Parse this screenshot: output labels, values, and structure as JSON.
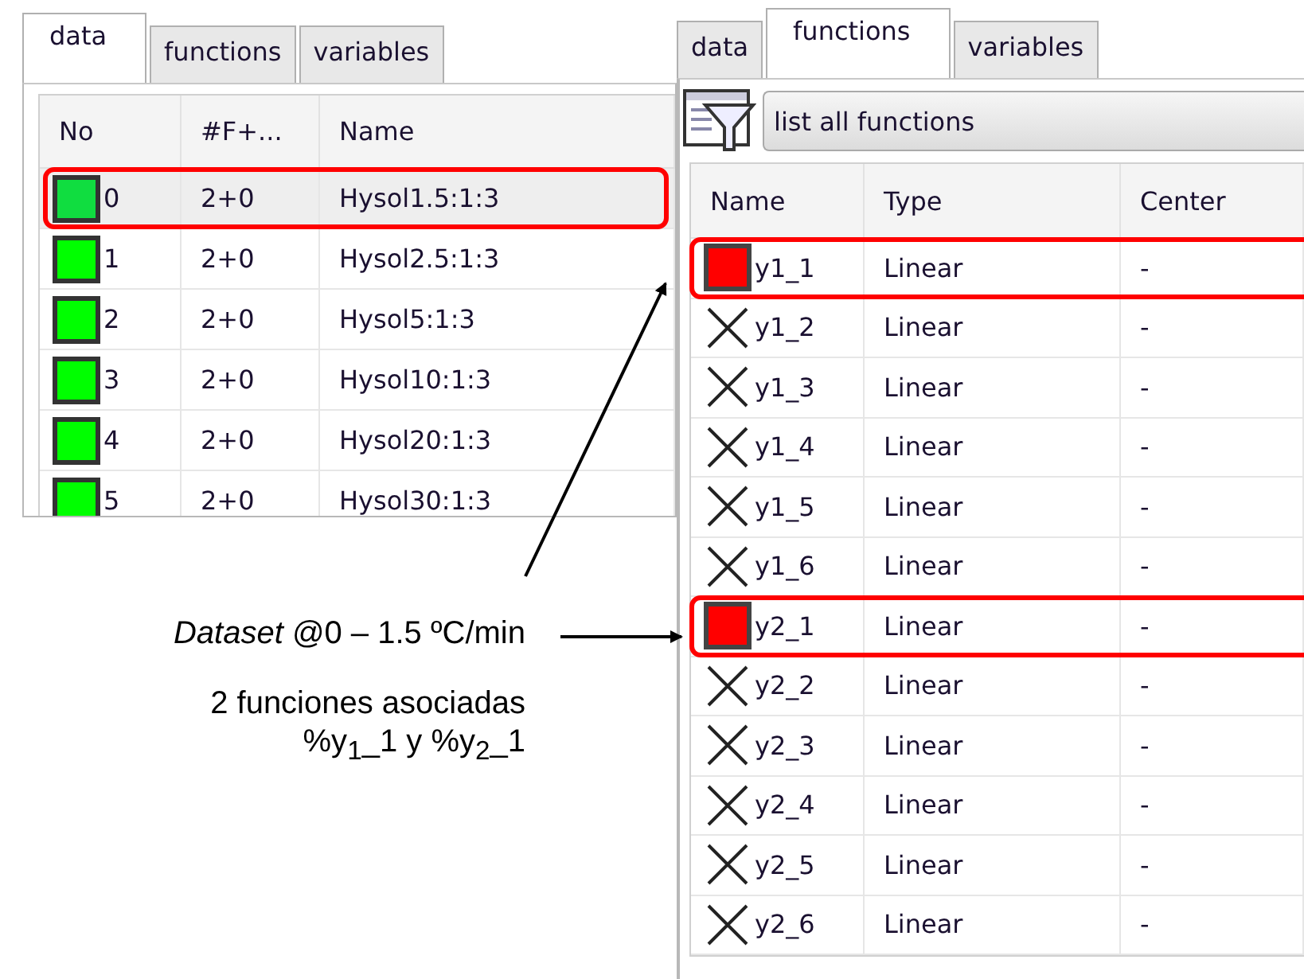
{
  "left_panel": {
    "tabs": [
      {
        "label": "data",
        "selected": true
      },
      {
        "label": "functions",
        "selected": false
      },
      {
        "label": "variables",
        "selected": false
      }
    ],
    "columns": [
      "No",
      "#F+...",
      "Name"
    ],
    "rows": [
      {
        "no": "0",
        "functions": "2+0",
        "name": "Hysol1.5:1:3",
        "selected": true,
        "highlighted": true
      },
      {
        "no": "1",
        "functions": "2+0",
        "name": "Hysol2.5:1:3",
        "selected": false,
        "highlighted": false
      },
      {
        "no": "2",
        "functions": "2+0",
        "name": "Hysol5:1:3",
        "selected": false,
        "highlighted": false
      },
      {
        "no": "3",
        "functions": "2+0",
        "name": "Hysol10:1:3",
        "selected": false,
        "highlighted": false
      },
      {
        "no": "4",
        "functions": "2+0",
        "name": "Hysol20:1:3",
        "selected": false,
        "highlighted": false
      },
      {
        "no": "5",
        "functions": "2+0",
        "name": "Hysol30:1:3",
        "selected": false,
        "highlighted": false
      }
    ]
  },
  "annotation": {
    "caption": "*Dataset* @0 – 1.5 ºC/min",
    "note_lines": [
      "2 funciones asociadas",
      "%y$_{1}$_1 y %y$_{2}$_1"
    ]
  },
  "right_panel": {
    "tabs": [
      {
        "label": "data",
        "selected": false
      },
      {
        "label": "functions",
        "selected": true
      },
      {
        "label": "variables",
        "selected": false
      }
    ],
    "filter": "list all functions",
    "columns": [
      "Name",
      "Type",
      "Center"
    ],
    "rows": [
      {
        "name": "y1_1",
        "type": "Linear",
        "center": "-",
        "shown": true,
        "highlighted": true
      },
      {
        "name": "y1_2",
        "type": "Linear",
        "center": "-",
        "shown": false,
        "highlighted": false
      },
      {
        "name": "y1_3",
        "type": "Linear",
        "center": "-",
        "shown": false,
        "highlighted": false
      },
      {
        "name": "y1_4",
        "type": "Linear",
        "center": "-",
        "shown": false,
        "highlighted": false
      },
      {
        "name": "y1_5",
        "type": "Linear",
        "center": "-",
        "shown": false,
        "highlighted": false
      },
      {
        "name": "y1_6",
        "type": "Linear",
        "center": "-",
        "shown": false,
        "highlighted": false
      },
      {
        "name": "y2_1",
        "type": "Linear",
        "center": "-",
        "shown": true,
        "highlighted": true
      },
      {
        "name": "y2_2",
        "type": "Linear",
        "center": "-",
        "shown": false,
        "highlighted": false
      },
      {
        "name": "y2_3",
        "type": "Linear",
        "center": "-",
        "shown": false,
        "highlighted": false
      },
      {
        "name": "y2_4",
        "type": "Linear",
        "center": "-",
        "shown": false,
        "highlighted": false
      },
      {
        "name": "y2_5",
        "type": "Linear",
        "center": "-",
        "shown": false,
        "highlighted": false
      },
      {
        "name": "y2_6",
        "type": "Linear",
        "center": "-",
        "shown": false,
        "highlighted": false
      }
    ]
  }
}
